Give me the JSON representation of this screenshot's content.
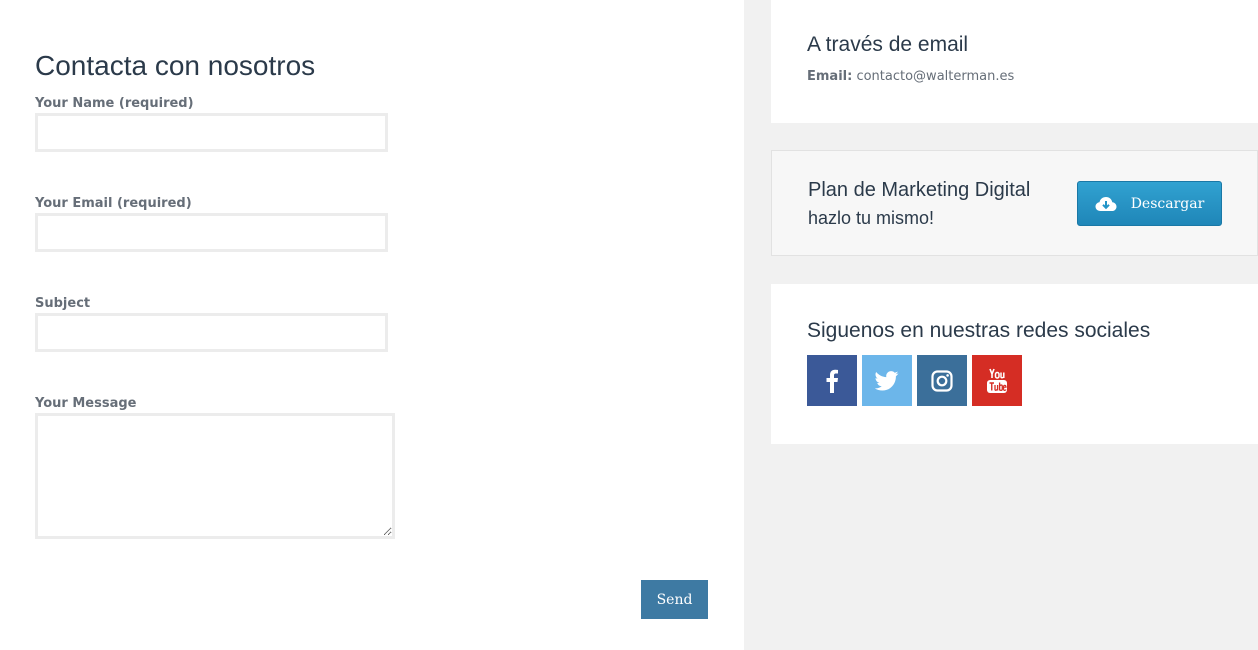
{
  "contact_form": {
    "title": "Contacta con nosotros",
    "name_label": "Your Name (required)",
    "name_value": "",
    "email_label": "Your Email (required)",
    "email_value": "",
    "subject_label": "Subject",
    "subject_value": "",
    "message_label": "Your Message",
    "message_value": "",
    "send_label": "Send"
  },
  "sidebar": {
    "email_card": {
      "title": "A través de email",
      "email_label": "Email:",
      "email_value": "contacto@walterman.es"
    },
    "plan_card": {
      "title": "Plan de Marketing Digital",
      "subtitle": "hazlo tu mismo!",
      "button_label": "Descargar",
      "button_icon": "cloud-download-icon"
    },
    "social_card": {
      "title": "Siguenos en nuestras redes sociales",
      "networks": [
        {
          "icon": "facebook-icon",
          "color": "#3b5998"
        },
        {
          "icon": "twitter-icon",
          "color": "#6cb6ea"
        },
        {
          "icon": "instagram-icon",
          "color": "#3b6f9a"
        },
        {
          "icon": "youtube-icon",
          "color": "#d52d24"
        }
      ]
    }
  },
  "colors": {
    "accent": "#3e7aa3",
    "download_button": "#2394c7",
    "heading": "#2b3a4a"
  }
}
